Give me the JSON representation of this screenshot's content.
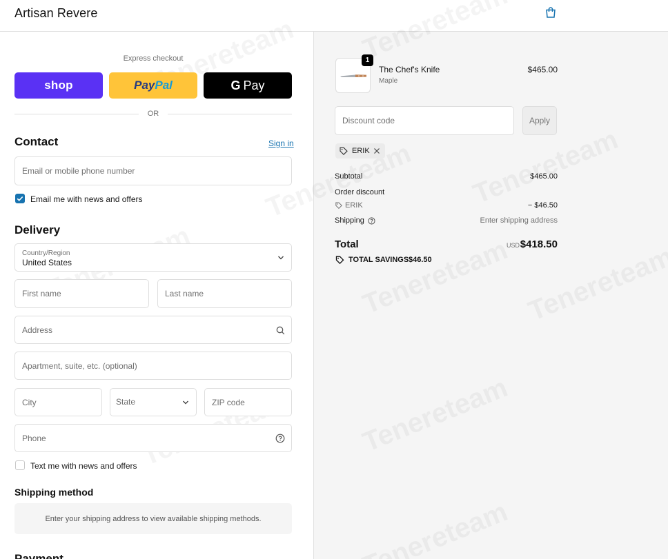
{
  "header": {
    "brand": "Artisan Revere",
    "cart_icon": "shopping-bag-icon"
  },
  "express": {
    "label": "Express checkout",
    "shop_label": "shop",
    "paypal_part1": "Pay",
    "paypal_part2": "Pal",
    "gpay_g": "G",
    "gpay_label": "Pay",
    "or_label": "OR"
  },
  "contact": {
    "heading": "Contact",
    "sign_in": "Sign in",
    "email_placeholder": "Email or mobile phone number",
    "news_label": "Email me with news and offers",
    "news_checked": true
  },
  "delivery": {
    "heading": "Delivery",
    "country_label": "Country/Region",
    "country_value": "United States",
    "first_name": "First name",
    "last_name": "Last name",
    "address": "Address",
    "apartment": "Apartment, suite, etc. (optional)",
    "city": "City",
    "state": "State",
    "zip": "ZIP code",
    "phone": "Phone",
    "sms_label": "Text me with news and offers",
    "sms_checked": false
  },
  "shipping_method": {
    "heading": "Shipping method",
    "message": "Enter your shipping address to view available shipping methods."
  },
  "payment": {
    "heading": "Payment"
  },
  "summary": {
    "product_name": "The Chef's Knife",
    "product_variant": "Maple",
    "product_price": "$465.00",
    "quantity": "1",
    "discount_placeholder": "Discount code",
    "apply_label": "Apply",
    "applied_code": "ERIK",
    "subtotal_label": "Subtotal",
    "subtotal_value": "$465.00",
    "order_discount_label": "Order discount",
    "discount_code": "ERIK",
    "discount_value": "− $46.50",
    "shipping_label": "Shipping",
    "shipping_value": "Enter shipping address",
    "total_label": "Total",
    "currency": "USD",
    "total_value": "$418.50",
    "savings_label": "TOTAL SAVINGS",
    "savings_value": "$46.50"
  },
  "watermark": "Tenereteam",
  "colors": {
    "accent": "#1773b0",
    "shop_pay": "#5a31f4",
    "paypal": "#ffc439"
  }
}
